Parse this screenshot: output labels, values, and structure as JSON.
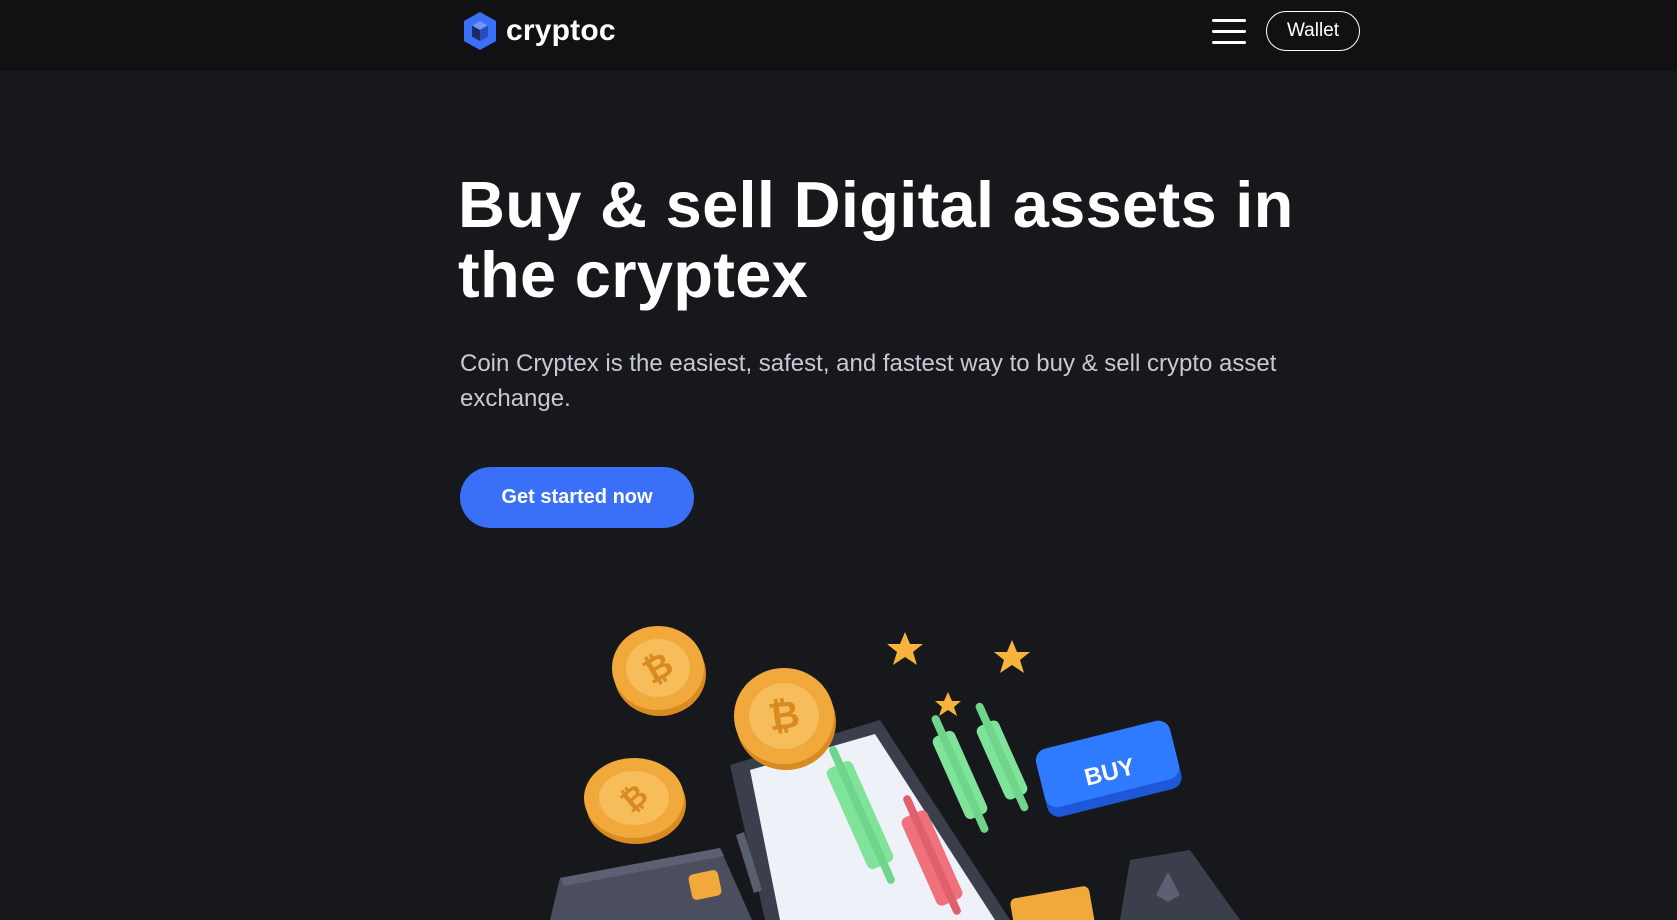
{
  "header": {
    "brand_name": "cryptoc",
    "menu_icon": "hamburger-menu-icon",
    "wallet_label": "Wallet"
  },
  "hero": {
    "title": "Buy & sell Digital assets in the cryptex",
    "subtitle": "Coin Cryptex is the easiest, safest, and fastest way to buy & sell crypto asset exchange.",
    "cta_label": "Get started now"
  },
  "illustration": {
    "buy_label": "BUY",
    "coin_symbol": "₿"
  },
  "colors": {
    "background": "#17181c",
    "header_background": "#111113",
    "accent": "#3a6ff8",
    "text_primary": "#ffffff",
    "text_secondary": "#c7c9d6",
    "coin": "#f2a93b",
    "candle_green": "#7fe39a",
    "candle_red": "#f0707c",
    "star": "#f6b43c"
  }
}
